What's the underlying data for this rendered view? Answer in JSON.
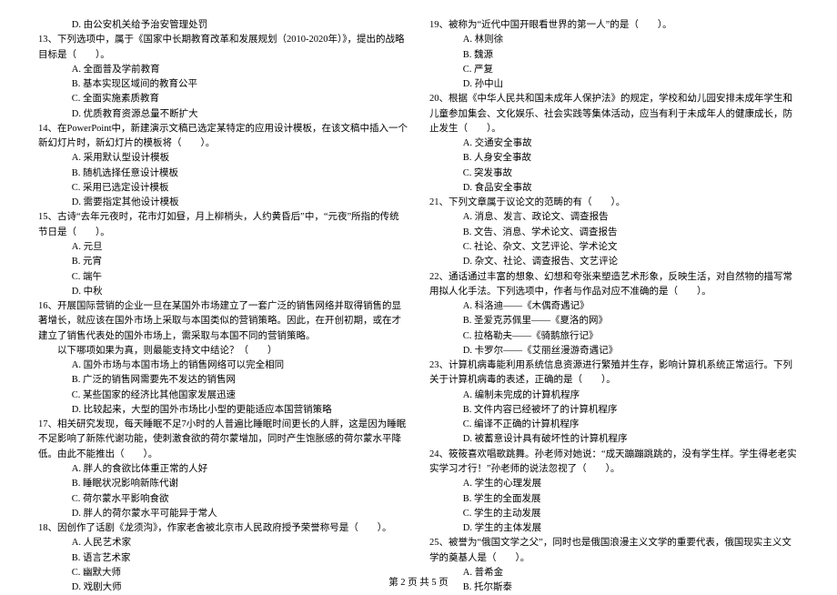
{
  "left": {
    "q12_optD": "D. 由公安机关给予治安管理处罚",
    "q13_stem": "13、下列选项中，属于《国家中长期教育改革和发展规划（2010-2020年）》，提出的战略目标是（　　）。",
    "q13_A": "A. 全面普及学前教育",
    "q13_B": "B. 基本实现区域间的教育公平",
    "q13_C": "C. 全面实施素质教育",
    "q13_D": "D. 优质教育资源总量不断扩大",
    "q14_stem": "14、在PowerPoint中，新建演示文稿已选定某特定的应用设计模板，在该文稿中插入一个新幻灯片时，新幻灯片的模板将（　　）。",
    "q14_A": "A. 采用默认型设计模板",
    "q14_B": "B. 随机选择任意设计模板",
    "q14_C": "C. 采用已选定设计模板",
    "q14_D": "D. 需要指定其他设计模板",
    "q15_stem": "15、古诗“去年元夜时，花市灯如昼，月上柳梢头，人约黄昏后”中，“元夜”所指的传统节日是（　　）。",
    "q15_A": "A. 元旦",
    "q15_B": "B. 元宵",
    "q15_C": "C. 端午",
    "q15_D": "D. 中秋",
    "q16_stem": "16、开展国际营销的企业一旦在某国外市场建立了一套广泛的销售网络并取得销售的显著增长，就应该在国外市场上采取与本国类似的营销策略。因此，在开创初期，或在才建立了销售代表处的国外市场上，需采取与本国不同的营销策略。",
    "q16_sub": "以下哪项如果为真，则最能支持文中结论？（　　）",
    "q16_A": "A. 国外市场与本国市场上的销售网络可以完全相同",
    "q16_B": "B. 广泛的销售网需要先不发达的销售网",
    "q16_C": "C. 某些国家的经济比其他国家发展迅速",
    "q16_D": "D. 比较起来，大型的国外市场比小型的更能适应本国营销策略",
    "q17_stem": "17、相关研究发现，每天睡眠不足7小时的人普遍比睡眠时间更长的人胖，这是因为睡眠不足影响了新陈代谢功能，使刺激食欲的荷尔蒙增加，同时产生饱胀感的荷尔蒙水平降低。由此不能推出（　　）。",
    "q17_A": "A. 胖人的食欲比体重正常的人好",
    "q17_B": "B. 睡眠状况影响新陈代谢",
    "q17_C": "C. 荷尔蒙水平影响食欲",
    "q17_D": "D. 胖人的荷尔蒙水平可能异于常人",
    "q18_stem": "18、因创作了话剧《龙须沟》，作家老舍被北京市人民政府授予荣誉称号是（　　）。",
    "q18_A": "A. 人民艺术家",
    "q18_B": "B. 语言艺术家",
    "q18_C": "C. 幽默大师",
    "q18_D": "D. 戏剧大师"
  },
  "right": {
    "q19_stem": "19、被称为“近代中国开眼看世界的第一人”的是（　　）。",
    "q19_A": "A. 林则徐",
    "q19_B": "B. 魏源",
    "q19_C": "C. 严复",
    "q19_D": "D. 孙中山",
    "q20_stem": "20、根据《中华人民共和国未成年人保护法》的规定，学校和幼儿园安排未成年学生和儿童参加集会、文化娱乐、社会实践等集体活动，应当有利于未成年人的健康成长，防止发生（　　）。",
    "q20_A": "A. 交通安全事故",
    "q20_B": "B. 人身安全事故",
    "q20_C": "C. 突发事故",
    "q20_D": "D. 食品安全事故",
    "q21_stem": "21、下列文章属于议论文的范畴的有（　　）。",
    "q21_A": "A. 消息、发言、政论文、调查报告",
    "q21_B": "B. 文告、消息、学术论文、调查报告",
    "q21_C": "C. 社论、杂文、文艺评论、学术论文",
    "q21_D": "D. 杂文、社论、调查报告、文艺评论",
    "q22_stem": "22、通话通过丰富的想象、幻想和夸张来塑造艺术形象，反映生活，对自然物的描写常用拟人化手法。下列选项中，作者与作品对应不准确的是（　　）。",
    "q22_A": "A. 科洛迪——《木偶奇遇记》",
    "q22_B": "B. 圣爱克苏佩里——《夏洛的网》",
    "q22_C": "C. 拉格勒夫——《骑鹅旅行记》",
    "q22_D": "D. 卡罗尔——《艾丽丝漫游奇遇记》",
    "q23_stem": "23、计算机病毒能利用系统信息资源进行繁殖并生存，影响计算机系统正常运行。下列关于计算机病毒的表述，正确的是（　　）。",
    "q23_A": "A. 编制未完成的计算机程序",
    "q23_B": "B. 文件内容已经被坏了的计算机程序",
    "q23_C": "C. 编译不正确的计算机程序",
    "q23_D": "D. 被蓄意设计具有破坏性的计算机程序",
    "q24_stem": "24、筱筱喜欢唱歌跳舞。孙老师对她说：“成天蹦蹦跳跳的，没有学生样。学生得老老实实学习才行！”孙老师的说法忽视了（　　）。",
    "q24_A": "A. 学生的心理发展",
    "q24_B": "B. 学生的全面发展",
    "q24_C": "C. 学生的主动发展",
    "q24_D": "D. 学生的主体发展",
    "q25_stem": "25、被誉为“俄国文学之父”，同时也是俄国浪漫主义文学的重要代表，俄国现实主义文学的奠基人是（　　）。",
    "q25_A": "A. 普希金",
    "q25_B": "B. 托尔斯泰"
  },
  "footer": "第 2 页 共 5 页"
}
